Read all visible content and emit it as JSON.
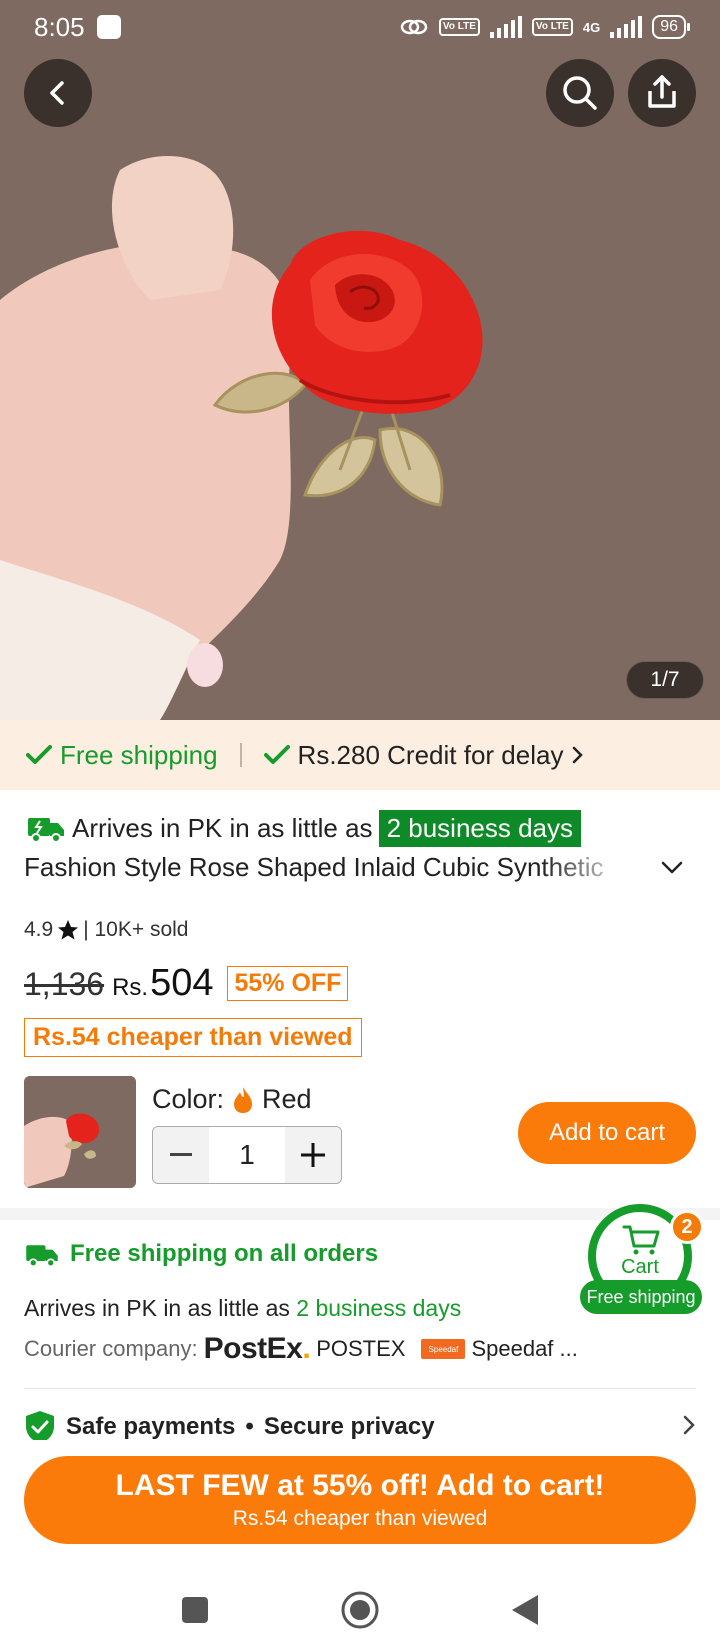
{
  "status_bar": {
    "time": "8:05",
    "battery": "96",
    "network": "4G",
    "volte": "Vo LTE"
  },
  "gallery": {
    "counter": "1/7"
  },
  "shipping_strip": {
    "free_shipping": "Free shipping",
    "credit": "Rs.280 Credit for delay"
  },
  "product": {
    "arrives_prefix": "Arrives in PK in as little as",
    "arrives_badge": "2 business days",
    "title": "Fashion Style Rose Shaped Inlaid Cubic Synthetic",
    "rating": "4.9",
    "sold": "| 10K+ sold",
    "old_price": "1,136",
    "currency": "Rs.",
    "price": "504",
    "discount": "55% OFF",
    "cheaper": "Rs.54 cheaper than viewed"
  },
  "sku": {
    "color_label": "Color:",
    "color_value": "Red",
    "quantity": "1",
    "add_to_cart": "Add to cart"
  },
  "shipping_info": {
    "free_all": "Free shipping on all orders",
    "arrives_prefix": "Arrives in PK in as little as",
    "arrives_days": "2 business days",
    "courier_label": "Courier company:",
    "postex_logo": "PostEx",
    "postex_name": "POSTEX",
    "speedaf_logo": "Speedaf",
    "speedaf_name": "Speedaf ..."
  },
  "payments": {
    "safe": "Safe payments",
    "bullet": "•",
    "privacy": "Secure privacy"
  },
  "floating_cart": {
    "label": "Cart",
    "count": "2",
    "tag": "Free shipping"
  },
  "cta": {
    "main": "LAST FEW at 55% off! Add to cart!",
    "sub": "Rs.54 cheaper than viewed"
  },
  "colors": {
    "accent_orange": "#fa7a0a",
    "green": "#159c2a",
    "hero_bg": "#7e6a60"
  }
}
